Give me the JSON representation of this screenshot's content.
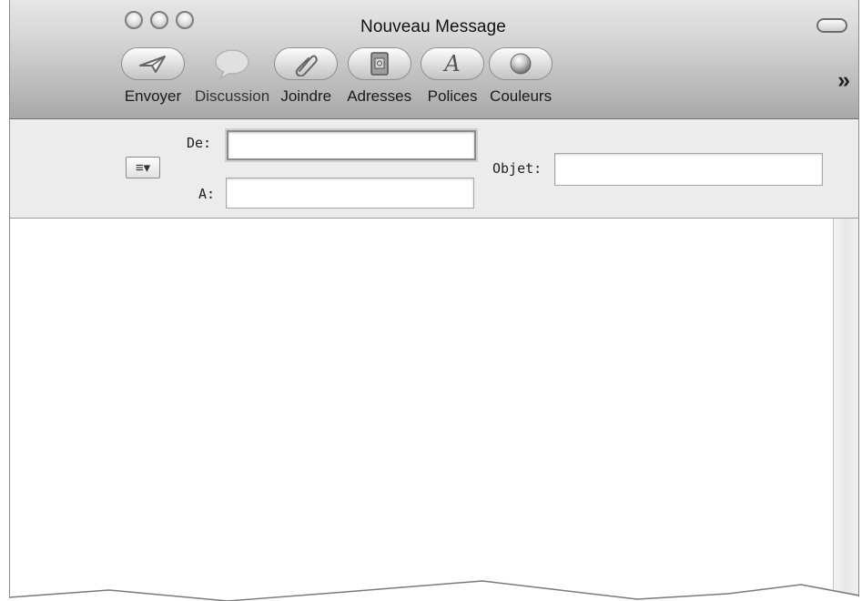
{
  "window": {
    "title": "Nouveau Message"
  },
  "toolbar": {
    "items": [
      {
        "label": "Envoyer",
        "icon": "send-plane-icon"
      },
      {
        "label": "Discussion",
        "icon": "chat-bubble-icon"
      },
      {
        "label": "Joindre",
        "icon": "paperclip-icon"
      },
      {
        "label": "Adresses",
        "icon": "address-book-icon"
      },
      {
        "label": "Polices",
        "icon": "font-a-icon"
      },
      {
        "label": "Couleurs",
        "icon": "color-sphere-icon"
      }
    ],
    "overflow": "»",
    "font_icon_text": "A"
  },
  "header": {
    "account_menu_glyph": "≡▾",
    "from_label": "De:",
    "to_label": "A:",
    "subject_label": "Objet:",
    "from_value": "",
    "to_value": "",
    "subject_value": ""
  }
}
